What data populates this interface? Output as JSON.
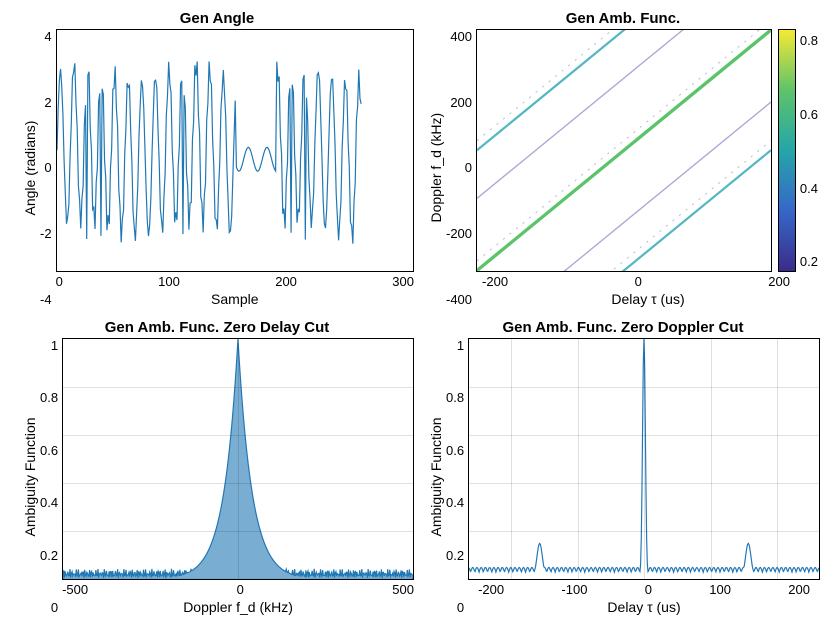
{
  "chart_data": [
    {
      "type": "line",
      "title": "Gen Angle",
      "xlabel": "Sample",
      "ylabel": "Angle (radians)",
      "xlim": [
        0,
        300
      ],
      "ylim": [
        -4,
        4
      ],
      "xticks": [
        0,
        100,
        200,
        300
      ],
      "yticks": [
        -4,
        -2,
        0,
        2,
        4
      ],
      "note": "Dense oscillating phase-wrapped signal roughly between -3 and 3 radians over ~256 samples; phase unwrap discontinuities visible near sample ~160-180.",
      "n_samples": 256,
      "amplitude_approx": 3.0
    },
    {
      "type": "heatmap",
      "title": "Gen Amb. Func.",
      "xlabel": "Delay  τ  (us)",
      "ylabel": "Doppler  f_d  (kHz)",
      "xlim": [
        -250,
        250
      ],
      "ylim": [
        -500,
        500
      ],
      "xticks": [
        -200,
        0,
        200
      ],
      "yticks": [
        -400,
        -200,
        0,
        200,
        400
      ],
      "colorbar_range": [
        0.1,
        0.9
      ],
      "colorbar_ticks": [
        0.2,
        0.4,
        0.6,
        0.8
      ],
      "ridges": [
        {
          "slope_kHz_per_us": 2.0,
          "intercept_doppler_at_tau0": 0,
          "strength": 0.9
        },
        {
          "slope_kHz_per_us": 2.0,
          "intercept_doppler_at_tau0": 500,
          "strength": 0.6
        },
        {
          "slope_kHz_per_us": 2.0,
          "intercept_doppler_at_tau0": -500,
          "strength": 0.6
        },
        {
          "slope_kHz_per_us": 2.0,
          "intercept_doppler_at_tau0": 300,
          "strength": 0.25
        },
        {
          "slope_kHz_per_us": 2.0,
          "intercept_doppler_at_tau0": -300,
          "strength": 0.25
        }
      ]
    },
    {
      "type": "line",
      "title": "Gen Amb. Func. Zero Delay Cut",
      "xlabel": "Doppler  f_d  (kHz)",
      "ylabel": "Ambiguity Function",
      "xlim": [
        -500,
        500
      ],
      "ylim": [
        0,
        1
      ],
      "xticks": [
        -500,
        0,
        500
      ],
      "yticks": [
        0,
        0.2,
        0.4,
        0.6,
        0.8,
        1
      ],
      "peak": {
        "x": 0,
        "y": 1.0
      },
      "sidelobe_floor_approx": 0.03,
      "half_width_kHz_approx": 10
    },
    {
      "type": "line",
      "title": "Gen Amb. Func. Zero Doppler Cut",
      "xlabel": "Delay  τ  (us)",
      "ylabel": "Ambiguity Function",
      "xlim": [
        -260,
        260
      ],
      "ylim": [
        0,
        1
      ],
      "xticks": [
        -200,
        -100,
        0,
        100,
        200
      ],
      "yticks": [
        0,
        0.2,
        0.4,
        0.6,
        0.8,
        1
      ],
      "peak": {
        "x": 0,
        "y": 1.0
      },
      "sidelobe_floor_approx": 0.05,
      "secondary_peaks_us": [
        -155,
        155
      ],
      "secondary_peak_level_approx": 0.15
    }
  ],
  "panels": {
    "p0": {
      "title": "Gen Angle",
      "xlabel": "Sample",
      "ylabel": "Angle (radians)"
    },
    "p1": {
      "title": "Gen Amb. Func.",
      "xlabel": "Delay  τ  (us)",
      "ylabel": "Doppler  fₙ  (kHz)",
      "ylabel_plain": "Doppler  f_d  (kHz)"
    },
    "p2": {
      "title": "Gen Amb. Func. Zero Delay Cut",
      "xlabel": "Doppler  f_d  (kHz)",
      "ylabel": "Ambiguity Function"
    },
    "p3": {
      "title": "Gen Amb. Func. Zero Doppler Cut",
      "xlabel": "Delay  τ  (us)",
      "ylabel": "Ambiguity Function"
    }
  },
  "ticks": {
    "p0x": [
      "0",
      "100",
      "200",
      "300"
    ],
    "p0y": [
      "4",
      "2",
      "0",
      "-2",
      "-4"
    ],
    "p1x": [
      "-200",
      "0",
      "200"
    ],
    "p1y": [
      "400",
      "200",
      "0",
      "-200",
      "-400"
    ],
    "p2x": [
      "-500",
      "0",
      "500"
    ],
    "p2y": [
      "1",
      "0.8",
      "0.6",
      "0.4",
      "0.2",
      "0"
    ],
    "p3x": [
      "-200",
      "-100",
      "0",
      "100",
      "200"
    ],
    "p3y": [
      "1",
      "0.8",
      "0.6",
      "0.4",
      "0.2",
      "0"
    ],
    "cb": [
      "0.8",
      "0.6",
      "0.4",
      "0.2"
    ]
  }
}
